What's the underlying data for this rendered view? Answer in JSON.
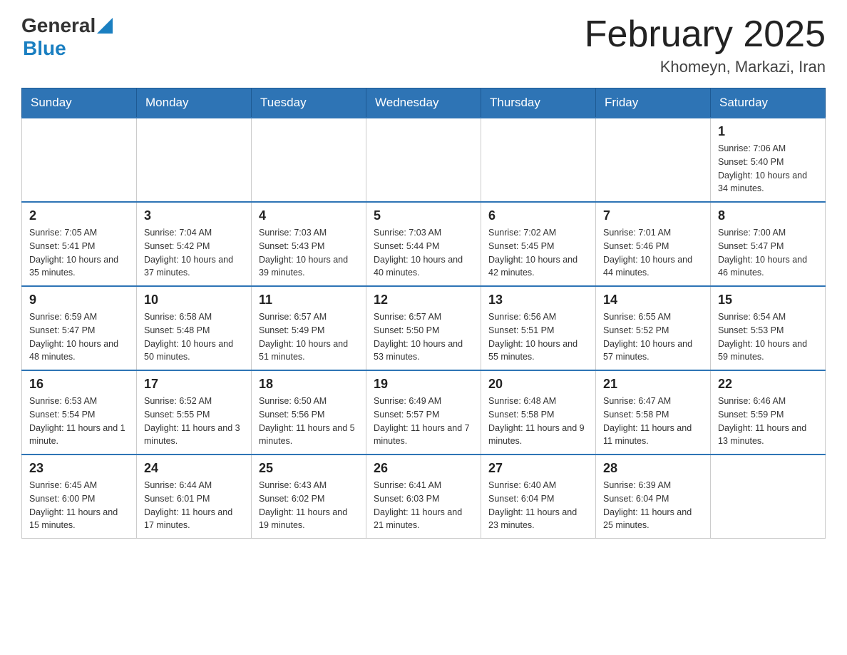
{
  "header": {
    "logo_general": "General",
    "logo_blue": "Blue",
    "month_title": "February 2025",
    "location": "Khomeyn, Markazi, Iran"
  },
  "weekdays": [
    "Sunday",
    "Monday",
    "Tuesday",
    "Wednesday",
    "Thursday",
    "Friday",
    "Saturday"
  ],
  "weeks": [
    [
      {
        "day": "",
        "sunrise": "",
        "sunset": "",
        "daylight": ""
      },
      {
        "day": "",
        "sunrise": "",
        "sunset": "",
        "daylight": ""
      },
      {
        "day": "",
        "sunrise": "",
        "sunset": "",
        "daylight": ""
      },
      {
        "day": "",
        "sunrise": "",
        "sunset": "",
        "daylight": ""
      },
      {
        "day": "",
        "sunrise": "",
        "sunset": "",
        "daylight": ""
      },
      {
        "day": "",
        "sunrise": "",
        "sunset": "",
        "daylight": ""
      },
      {
        "day": "1",
        "sunrise": "Sunrise: 7:06 AM",
        "sunset": "Sunset: 5:40 PM",
        "daylight": "Daylight: 10 hours and 34 minutes."
      }
    ],
    [
      {
        "day": "2",
        "sunrise": "Sunrise: 7:05 AM",
        "sunset": "Sunset: 5:41 PM",
        "daylight": "Daylight: 10 hours and 35 minutes."
      },
      {
        "day": "3",
        "sunrise": "Sunrise: 7:04 AM",
        "sunset": "Sunset: 5:42 PM",
        "daylight": "Daylight: 10 hours and 37 minutes."
      },
      {
        "day": "4",
        "sunrise": "Sunrise: 7:03 AM",
        "sunset": "Sunset: 5:43 PM",
        "daylight": "Daylight: 10 hours and 39 minutes."
      },
      {
        "day": "5",
        "sunrise": "Sunrise: 7:03 AM",
        "sunset": "Sunset: 5:44 PM",
        "daylight": "Daylight: 10 hours and 40 minutes."
      },
      {
        "day": "6",
        "sunrise": "Sunrise: 7:02 AM",
        "sunset": "Sunset: 5:45 PM",
        "daylight": "Daylight: 10 hours and 42 minutes."
      },
      {
        "day": "7",
        "sunrise": "Sunrise: 7:01 AM",
        "sunset": "Sunset: 5:46 PM",
        "daylight": "Daylight: 10 hours and 44 minutes."
      },
      {
        "day": "8",
        "sunrise": "Sunrise: 7:00 AM",
        "sunset": "Sunset: 5:47 PM",
        "daylight": "Daylight: 10 hours and 46 minutes."
      }
    ],
    [
      {
        "day": "9",
        "sunrise": "Sunrise: 6:59 AM",
        "sunset": "Sunset: 5:47 PM",
        "daylight": "Daylight: 10 hours and 48 minutes."
      },
      {
        "day": "10",
        "sunrise": "Sunrise: 6:58 AM",
        "sunset": "Sunset: 5:48 PM",
        "daylight": "Daylight: 10 hours and 50 minutes."
      },
      {
        "day": "11",
        "sunrise": "Sunrise: 6:57 AM",
        "sunset": "Sunset: 5:49 PM",
        "daylight": "Daylight: 10 hours and 51 minutes."
      },
      {
        "day": "12",
        "sunrise": "Sunrise: 6:57 AM",
        "sunset": "Sunset: 5:50 PM",
        "daylight": "Daylight: 10 hours and 53 minutes."
      },
      {
        "day": "13",
        "sunrise": "Sunrise: 6:56 AM",
        "sunset": "Sunset: 5:51 PM",
        "daylight": "Daylight: 10 hours and 55 minutes."
      },
      {
        "day": "14",
        "sunrise": "Sunrise: 6:55 AM",
        "sunset": "Sunset: 5:52 PM",
        "daylight": "Daylight: 10 hours and 57 minutes."
      },
      {
        "day": "15",
        "sunrise": "Sunrise: 6:54 AM",
        "sunset": "Sunset: 5:53 PM",
        "daylight": "Daylight: 10 hours and 59 minutes."
      }
    ],
    [
      {
        "day": "16",
        "sunrise": "Sunrise: 6:53 AM",
        "sunset": "Sunset: 5:54 PM",
        "daylight": "Daylight: 11 hours and 1 minute."
      },
      {
        "day": "17",
        "sunrise": "Sunrise: 6:52 AM",
        "sunset": "Sunset: 5:55 PM",
        "daylight": "Daylight: 11 hours and 3 minutes."
      },
      {
        "day": "18",
        "sunrise": "Sunrise: 6:50 AM",
        "sunset": "Sunset: 5:56 PM",
        "daylight": "Daylight: 11 hours and 5 minutes."
      },
      {
        "day": "19",
        "sunrise": "Sunrise: 6:49 AM",
        "sunset": "Sunset: 5:57 PM",
        "daylight": "Daylight: 11 hours and 7 minutes."
      },
      {
        "day": "20",
        "sunrise": "Sunrise: 6:48 AM",
        "sunset": "Sunset: 5:58 PM",
        "daylight": "Daylight: 11 hours and 9 minutes."
      },
      {
        "day": "21",
        "sunrise": "Sunrise: 6:47 AM",
        "sunset": "Sunset: 5:58 PM",
        "daylight": "Daylight: 11 hours and 11 minutes."
      },
      {
        "day": "22",
        "sunrise": "Sunrise: 6:46 AM",
        "sunset": "Sunset: 5:59 PM",
        "daylight": "Daylight: 11 hours and 13 minutes."
      }
    ],
    [
      {
        "day": "23",
        "sunrise": "Sunrise: 6:45 AM",
        "sunset": "Sunset: 6:00 PM",
        "daylight": "Daylight: 11 hours and 15 minutes."
      },
      {
        "day": "24",
        "sunrise": "Sunrise: 6:44 AM",
        "sunset": "Sunset: 6:01 PM",
        "daylight": "Daylight: 11 hours and 17 minutes."
      },
      {
        "day": "25",
        "sunrise": "Sunrise: 6:43 AM",
        "sunset": "Sunset: 6:02 PM",
        "daylight": "Daylight: 11 hours and 19 minutes."
      },
      {
        "day": "26",
        "sunrise": "Sunrise: 6:41 AM",
        "sunset": "Sunset: 6:03 PM",
        "daylight": "Daylight: 11 hours and 21 minutes."
      },
      {
        "day": "27",
        "sunrise": "Sunrise: 6:40 AM",
        "sunset": "Sunset: 6:04 PM",
        "daylight": "Daylight: 11 hours and 23 minutes."
      },
      {
        "day": "28",
        "sunrise": "Sunrise: 6:39 AM",
        "sunset": "Sunset: 6:04 PM",
        "daylight": "Daylight: 11 hours and 25 minutes."
      },
      {
        "day": "",
        "sunrise": "",
        "sunset": "",
        "daylight": ""
      }
    ]
  ]
}
